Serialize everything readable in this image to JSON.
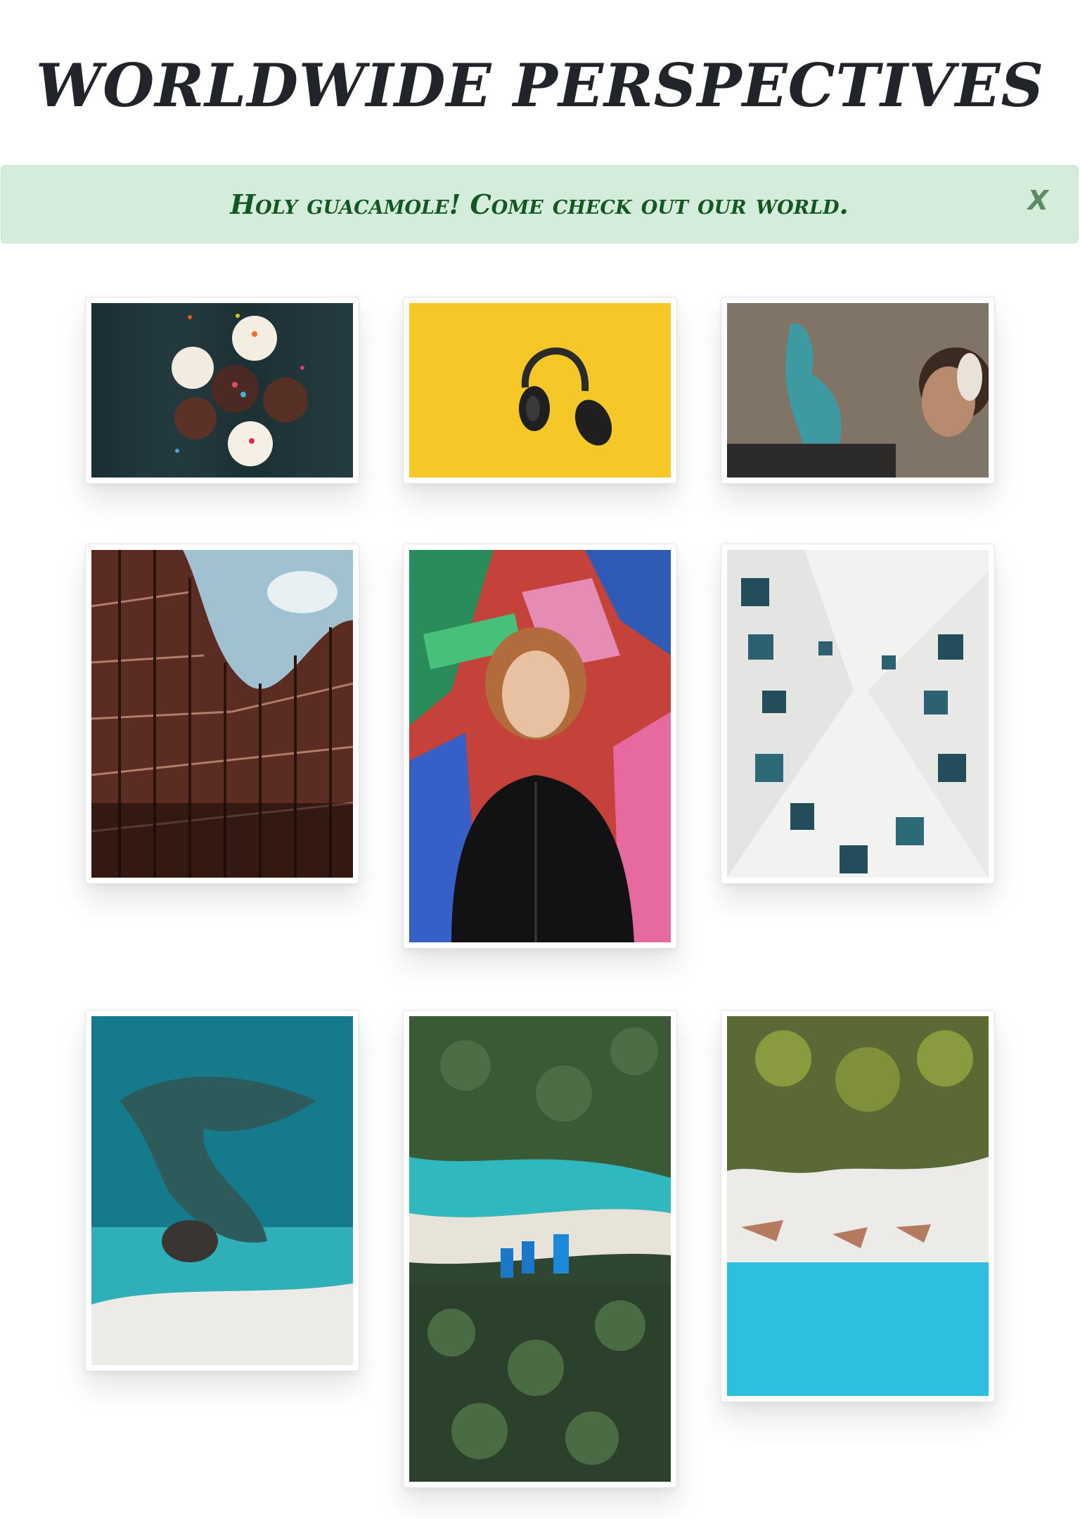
{
  "header": {
    "title": "WORLDWIDE PERSPECTIVES"
  },
  "alert": {
    "message": "Holy guacamole! Come check out our world.",
    "close_label": "X"
  },
  "gallery": {
    "photos": [
      {
        "subject": "cupcakes"
      },
      {
        "subject": "headphones"
      },
      {
        "subject": "graffiti-woman"
      },
      {
        "subject": "curved-building"
      },
      {
        "subject": "girl-portrait"
      },
      {
        "subject": "white-building"
      },
      {
        "subject": "aerial-reef"
      },
      {
        "subject": "palm-beach-boats"
      },
      {
        "subject": "beach-palms-aerial"
      }
    ]
  },
  "colors": {
    "alert_bg": "#d4ecda",
    "alert_text": "#155724",
    "title": "#212529"
  }
}
